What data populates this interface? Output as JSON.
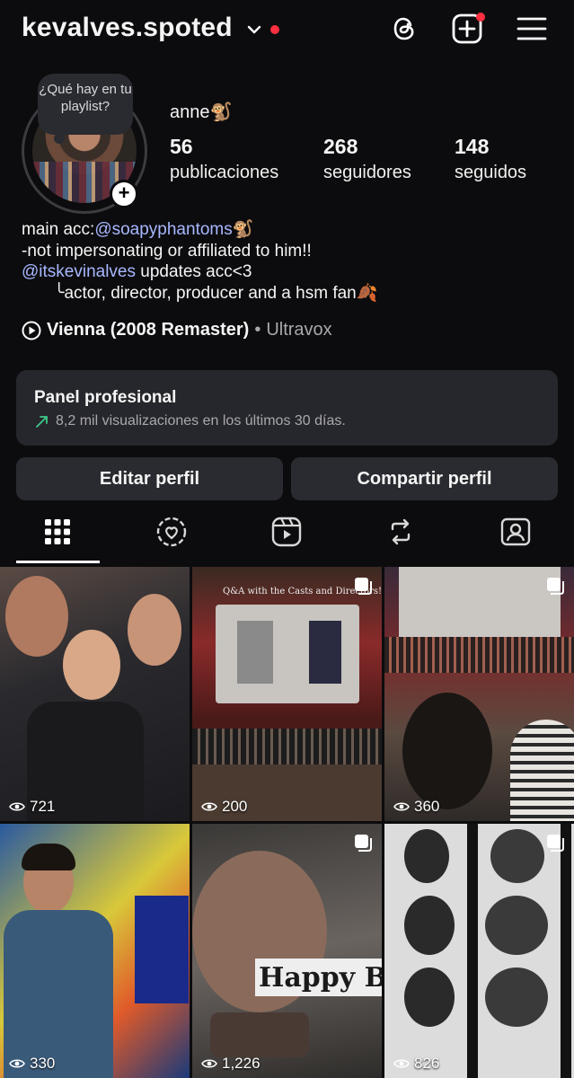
{
  "header": {
    "username": "kevalves.spoted"
  },
  "profile": {
    "note": "¿Qué hay en tu playlist?",
    "display_name": "anne🐒",
    "stats": [
      {
        "value": "56",
        "label": "publicaciones"
      },
      {
        "value": "268",
        "label": "seguidores"
      },
      {
        "value": "148",
        "label": "seguidos"
      }
    ],
    "bio": {
      "line1_prefix": "main acc:",
      "line1_link": "@soapyphantoms",
      "line1_suffix": "🐒",
      "line2": "-not impersonating or affiliated to him!!",
      "line3_link": "@itskevinalves",
      "line3_suffix": " updates acc<3",
      "line4": "╰actor, director, producer and a hsm fan🍂"
    },
    "music": {
      "song": "Vienna (2008 Remaster)",
      "separator": "•",
      "artist": "Ultravox"
    }
  },
  "panel": {
    "title": "Panel profesional",
    "subtitle": "8,2 mil visualizaciones en los últimos 30 días."
  },
  "buttons": {
    "edit": "Editar perfil",
    "share": "Compartir perfil"
  },
  "tabs": [
    "grid-icon",
    "collab-icon",
    "reels-icon",
    "reposts-icon",
    "tagged-icon"
  ],
  "posts": [
    {
      "views": "721",
      "multi": false
    },
    {
      "views": "200",
      "multi": true,
      "caption": "Q&A with the Casts and Directors!"
    },
    {
      "views": "360",
      "multi": true
    },
    {
      "views": "330",
      "multi": false
    },
    {
      "views": "1,226",
      "multi": true,
      "caption": "Happy B TO KEVI"
    },
    {
      "views": "826",
      "multi": true
    }
  ],
  "colors": {
    "background": "#0c0c0e",
    "accent_link": "#a8b8ff",
    "notification": "#ff3040",
    "surface": "#26272c"
  }
}
